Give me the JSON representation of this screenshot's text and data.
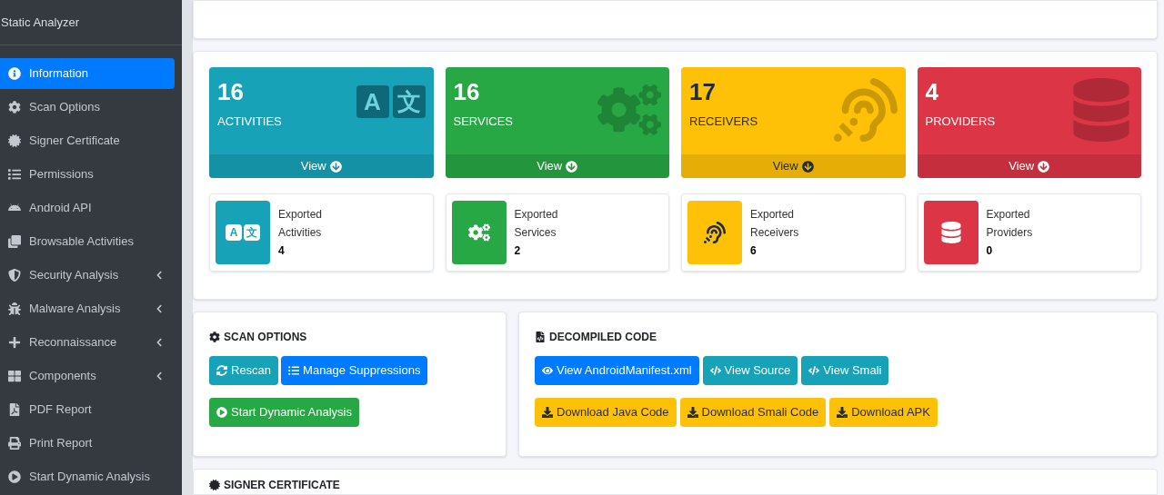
{
  "sidebar": {
    "brand": "Static Analyzer",
    "items": [
      {
        "label": "Information",
        "kind": "info",
        "selected": true,
        "has_submenu": false
      },
      {
        "label": "Scan Options",
        "kind": "cog",
        "selected": false,
        "has_submenu": false
      },
      {
        "label": "Signer Certificate",
        "kind": "certificate",
        "selected": false,
        "has_submenu": false
      },
      {
        "label": "Permissions",
        "kind": "list",
        "selected": false,
        "has_submenu": false
      },
      {
        "label": "Android API",
        "kind": "android",
        "selected": false,
        "has_submenu": false
      },
      {
        "label": "Browsable Activities",
        "kind": "clone",
        "selected": false,
        "has_submenu": false
      },
      {
        "label": "Security Analysis",
        "kind": "shield",
        "selected": false,
        "has_submenu": true
      },
      {
        "label": "Malware Analysis",
        "kind": "bug",
        "selected": false,
        "has_submenu": true
      },
      {
        "label": "Reconnaissance",
        "kind": "plus",
        "selected": false,
        "has_submenu": true
      },
      {
        "label": "Components",
        "kind": "grid",
        "selected": false,
        "has_submenu": true
      },
      {
        "label": "PDF Report",
        "kind": "pdf",
        "selected": false,
        "has_submenu": false
      },
      {
        "label": "Print Report",
        "kind": "print",
        "selected": false,
        "has_submenu": false
      },
      {
        "label": "Start Dynamic Analysis",
        "kind": "play",
        "selected": false,
        "has_submenu": false
      }
    ]
  },
  "stats": [
    {
      "kind": "activities",
      "icon_glyphs": [
        "A",
        "文"
      ],
      "exported_icon_glyphs": [
        "A",
        "文"
      ],
      "color": "#17a2b8",
      "count": "16",
      "label": "ACTIVITIES",
      "link": "View",
      "exported_title": "Exported",
      "exported_label": "Activities",
      "exported_count": "4"
    },
    {
      "kind": "services",
      "color": "#28a745",
      "count": "16",
      "label": "SERVICES",
      "link": "View",
      "exported_title": "Exported",
      "exported_label": "Services",
      "exported_count": "2"
    },
    {
      "kind": "receivers",
      "color": "#ffc107",
      "count": "17",
      "label": "RECEIVERS",
      "link": "View",
      "exported_title": "Exported",
      "exported_label": "Receivers",
      "exported_count": "6"
    },
    {
      "kind": "providers",
      "color": "#dc3545",
      "count": "4",
      "label": "PROVIDERS",
      "link": "View",
      "exported_title": "Exported",
      "exported_label": "Providers",
      "exported_count": "0"
    }
  ],
  "scan_options": {
    "title": "SCAN OPTIONS",
    "buttons": [
      {
        "label": "Rescan",
        "kind": "sync",
        "color": "#17a2b8"
      },
      {
        "label": "Manage Suppressions",
        "kind": "list",
        "color": "#007bff"
      },
      {
        "label": "Start Dynamic Analysis",
        "kind": "play",
        "color": "#28a745"
      }
    ]
  },
  "decompiled_code": {
    "title": "DECOMPILED CODE",
    "buttons": [
      {
        "label": "View AndroidManifest.xml",
        "kind": "eye",
        "color": "#007bff"
      },
      {
        "label": "View Source",
        "kind": "code",
        "color": "#17a2b8"
      },
      {
        "label": "View Smali",
        "kind": "code",
        "color": "#17a2b8"
      },
      {
        "label": "Download Java Code",
        "kind": "download",
        "color": "#ffc107"
      },
      {
        "label": "Download Smali Code",
        "kind": "download",
        "color": "#ffc107"
      },
      {
        "label": "Download APK",
        "kind": "download",
        "color": "#ffc107"
      }
    ]
  },
  "signer_certificate": {
    "title": "SIGNER CERTIFICATE"
  }
}
